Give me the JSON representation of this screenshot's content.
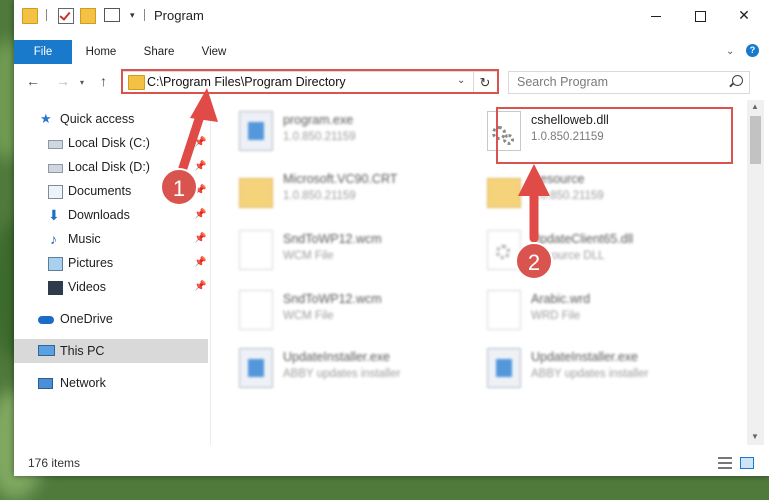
{
  "window": {
    "title": "Program"
  },
  "ribbon": {
    "tabs": [
      "File",
      "Home",
      "Share",
      "View"
    ],
    "help_label": "?"
  },
  "address_bar": {
    "path": "C:\\Program Files\\Program Directory",
    "refresh_glyph": "↻"
  },
  "search": {
    "placeholder": "Search Program"
  },
  "sidebar": {
    "items": [
      {
        "label": "Quick access",
        "icon": "star-icon",
        "pinned": false
      },
      {
        "label": "Local Disk (C:)",
        "icon": "drive-icon",
        "pinned": true
      },
      {
        "label": "Local Disk (D:)",
        "icon": "drive-icon",
        "pinned": true
      },
      {
        "label": "Documents",
        "icon": "documents-icon",
        "pinned": true
      },
      {
        "label": "Downloads",
        "icon": "download-icon",
        "pinned": true
      },
      {
        "label": "Music",
        "icon": "music-icon",
        "pinned": true
      },
      {
        "label": "Pictures",
        "icon": "pictures-icon",
        "pinned": true
      },
      {
        "label": "Videos",
        "icon": "videos-icon",
        "pinned": true
      },
      {
        "label": "OneDrive",
        "icon": "cloud-icon",
        "pinned": false
      },
      {
        "label": "This PC",
        "icon": "computer-icon",
        "pinned": false,
        "selected": true
      },
      {
        "label": "Network",
        "icon": "network-icon",
        "pinned": false
      }
    ]
  },
  "files": [
    {
      "name": "program.exe",
      "detail": "1.0.850.21159",
      "icon": "exe-icon"
    },
    {
      "name": "cshelloweb.dll",
      "detail": "1.0.850.21159",
      "icon": "dll-gear-icon",
      "highlighted": true
    },
    {
      "name": "Microsoft.VC90.CRT",
      "detail": "1.0.850.21159",
      "icon": "folder-icon"
    },
    {
      "name": "Resource",
      "detail": "1.0.850.21159",
      "icon": "folder-icon"
    },
    {
      "name": "SndToWP12.wcm",
      "detail": "WCM File",
      "icon": "file-icon"
    },
    {
      "name": "UpdateClient65.dll",
      "detail": "Resource DLL",
      "icon": "dll-gear-icon"
    },
    {
      "name": "SndToWP12.wcm",
      "detail": "WCM File",
      "icon": "file-icon"
    },
    {
      "name": "Arabic.wrd",
      "detail": "WRD File",
      "icon": "file-icon"
    },
    {
      "name": "UpdateInstaller.exe",
      "detail": "ABBY updates installer",
      "icon": "installer-icon"
    },
    {
      "name": "UpdateInstaller.exe",
      "detail": "ABBY updates installer",
      "icon": "installer-icon"
    }
  ],
  "status_bar": {
    "item_count": "176 items"
  },
  "annotations": {
    "step1": "1",
    "step2": "2",
    "highlight_color": "#d9534f"
  },
  "colors": {
    "accent": "#1979ca",
    "selection": "#d9d9d9"
  }
}
